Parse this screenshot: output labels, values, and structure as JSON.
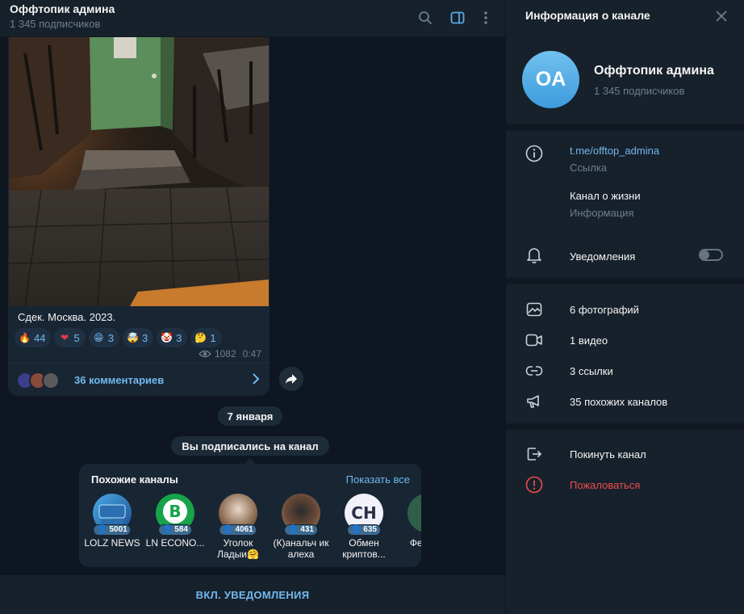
{
  "chat": {
    "title": "Оффтопик админа",
    "subscribers": "1 345 подписчиков"
  },
  "post": {
    "caption": "Сдек. Москва. 2023.",
    "reactions": [
      {
        "emoji": "🔥",
        "count": "44"
      },
      {
        "emoji": "❤",
        "count": "5"
      },
      {
        "emoji": "😁",
        "count": "3"
      },
      {
        "emoji": "🤯",
        "count": "3"
      },
      {
        "emoji": "🤡",
        "count": "3"
      },
      {
        "emoji": "🤔",
        "count": "1"
      }
    ],
    "views": "1082",
    "time": "0:47",
    "comments_label": "36 комментариев"
  },
  "service": {
    "date": "7 января",
    "subscribed": "Вы подписались на канал"
  },
  "similar": {
    "title": "Похожие каналы",
    "show_all": "Показать все",
    "channels": [
      {
        "name": "LOLZ NEWS",
        "subs": "5001"
      },
      {
        "name": "LN ECONO...",
        "subs": "584"
      },
      {
        "name": "Уголок Ладыи🤗",
        "subs": "4061"
      },
      {
        "name": "(К)анальч ик алеха",
        "subs": "431"
      },
      {
        "name": "Обмен криптов...",
        "subs": "635"
      },
      {
        "name": "Фе Калі",
        "subs": ""
      }
    ]
  },
  "bottom": {
    "notify": "ВКЛ. УВЕДОМЛЕНИЯ"
  },
  "info": {
    "header": "Информация о канале",
    "avatar_initials": "OA",
    "name": "Оффтопик админа",
    "subscribers": "1 345 подписчиков",
    "link": "t.me/offtop_admina",
    "link_label": "Ссылка",
    "description": "Канал о жизни",
    "description_label": "Информация",
    "notifications": "Уведомления",
    "notifications_on": false,
    "media": {
      "photos": "6 фотографий",
      "videos": "1 видео",
      "links": "3 ссылки",
      "similar": "35 похожих каналов"
    },
    "leave": "Покинуть канал",
    "report": "Пожаловаться"
  },
  "colors": {
    "accent": "#71b9ef",
    "danger": "#ec4c4c",
    "panel": "#17212b",
    "bubble": "#182533",
    "background": "#0e1621"
  }
}
